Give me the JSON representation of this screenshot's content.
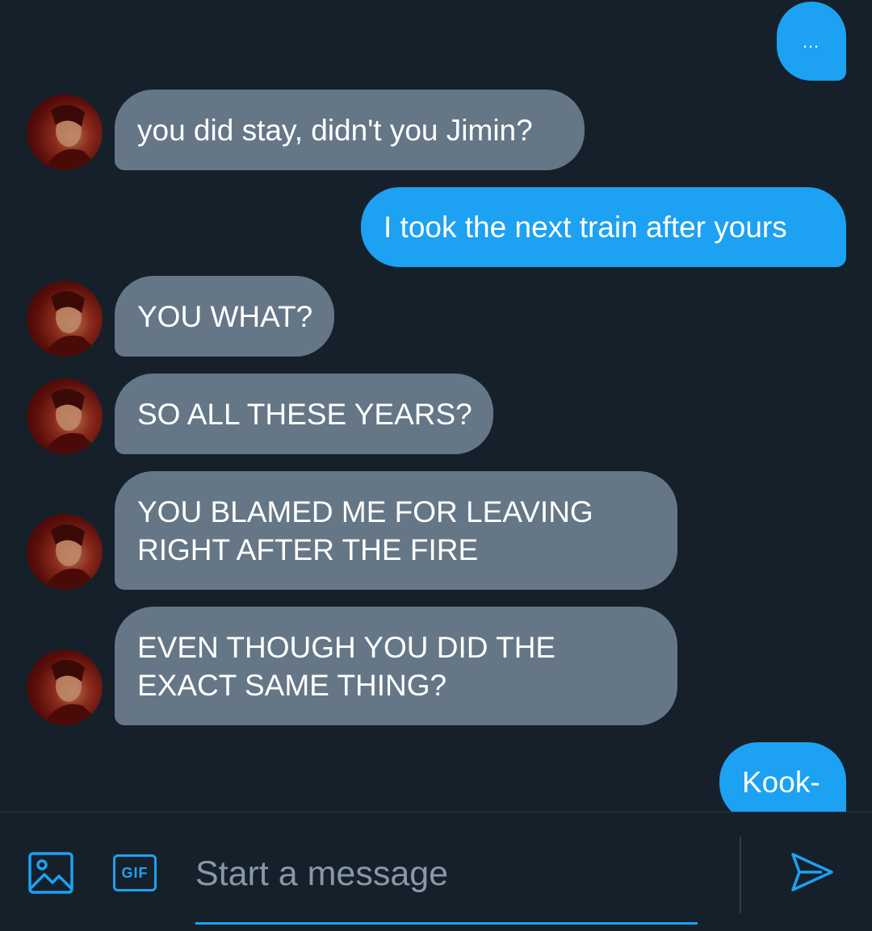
{
  "conversation": {
    "messages": [
      {
        "id": "m0",
        "direction": "sent",
        "text": "…"
      },
      {
        "id": "m1",
        "direction": "received",
        "text": "you did stay, didn't you Jimin?"
      },
      {
        "id": "m2",
        "direction": "sent",
        "text": "I took the next train after yours"
      },
      {
        "id": "m3",
        "direction": "received",
        "text": "YOU WHAT?"
      },
      {
        "id": "m4",
        "direction": "received",
        "text": "SO ALL THESE YEARS?"
      },
      {
        "id": "m5",
        "direction": "received",
        "line1": "YOU BLAMED ME FOR LEAVING",
        "line2": "RIGHT AFTER THE FIRE"
      },
      {
        "id": "m6",
        "direction": "received",
        "line1": "EVEN THOUGH YOU DID THE",
        "line2": "EXACT SAME THING?"
      },
      {
        "id": "m7",
        "direction": "sent",
        "text": "Kook-"
      }
    ]
  },
  "composer": {
    "image_icon": "image-icon",
    "gif_label": "GIF",
    "placeholder": "Start a message",
    "value": "",
    "send_icon": "send-icon"
  },
  "colors": {
    "background": "#15202b",
    "sent_bubble": "#1da1f2",
    "received_bubble": "#657786",
    "accent": "#1da1f2",
    "placeholder": "#8899a6",
    "divider": "#2b3b4b"
  }
}
